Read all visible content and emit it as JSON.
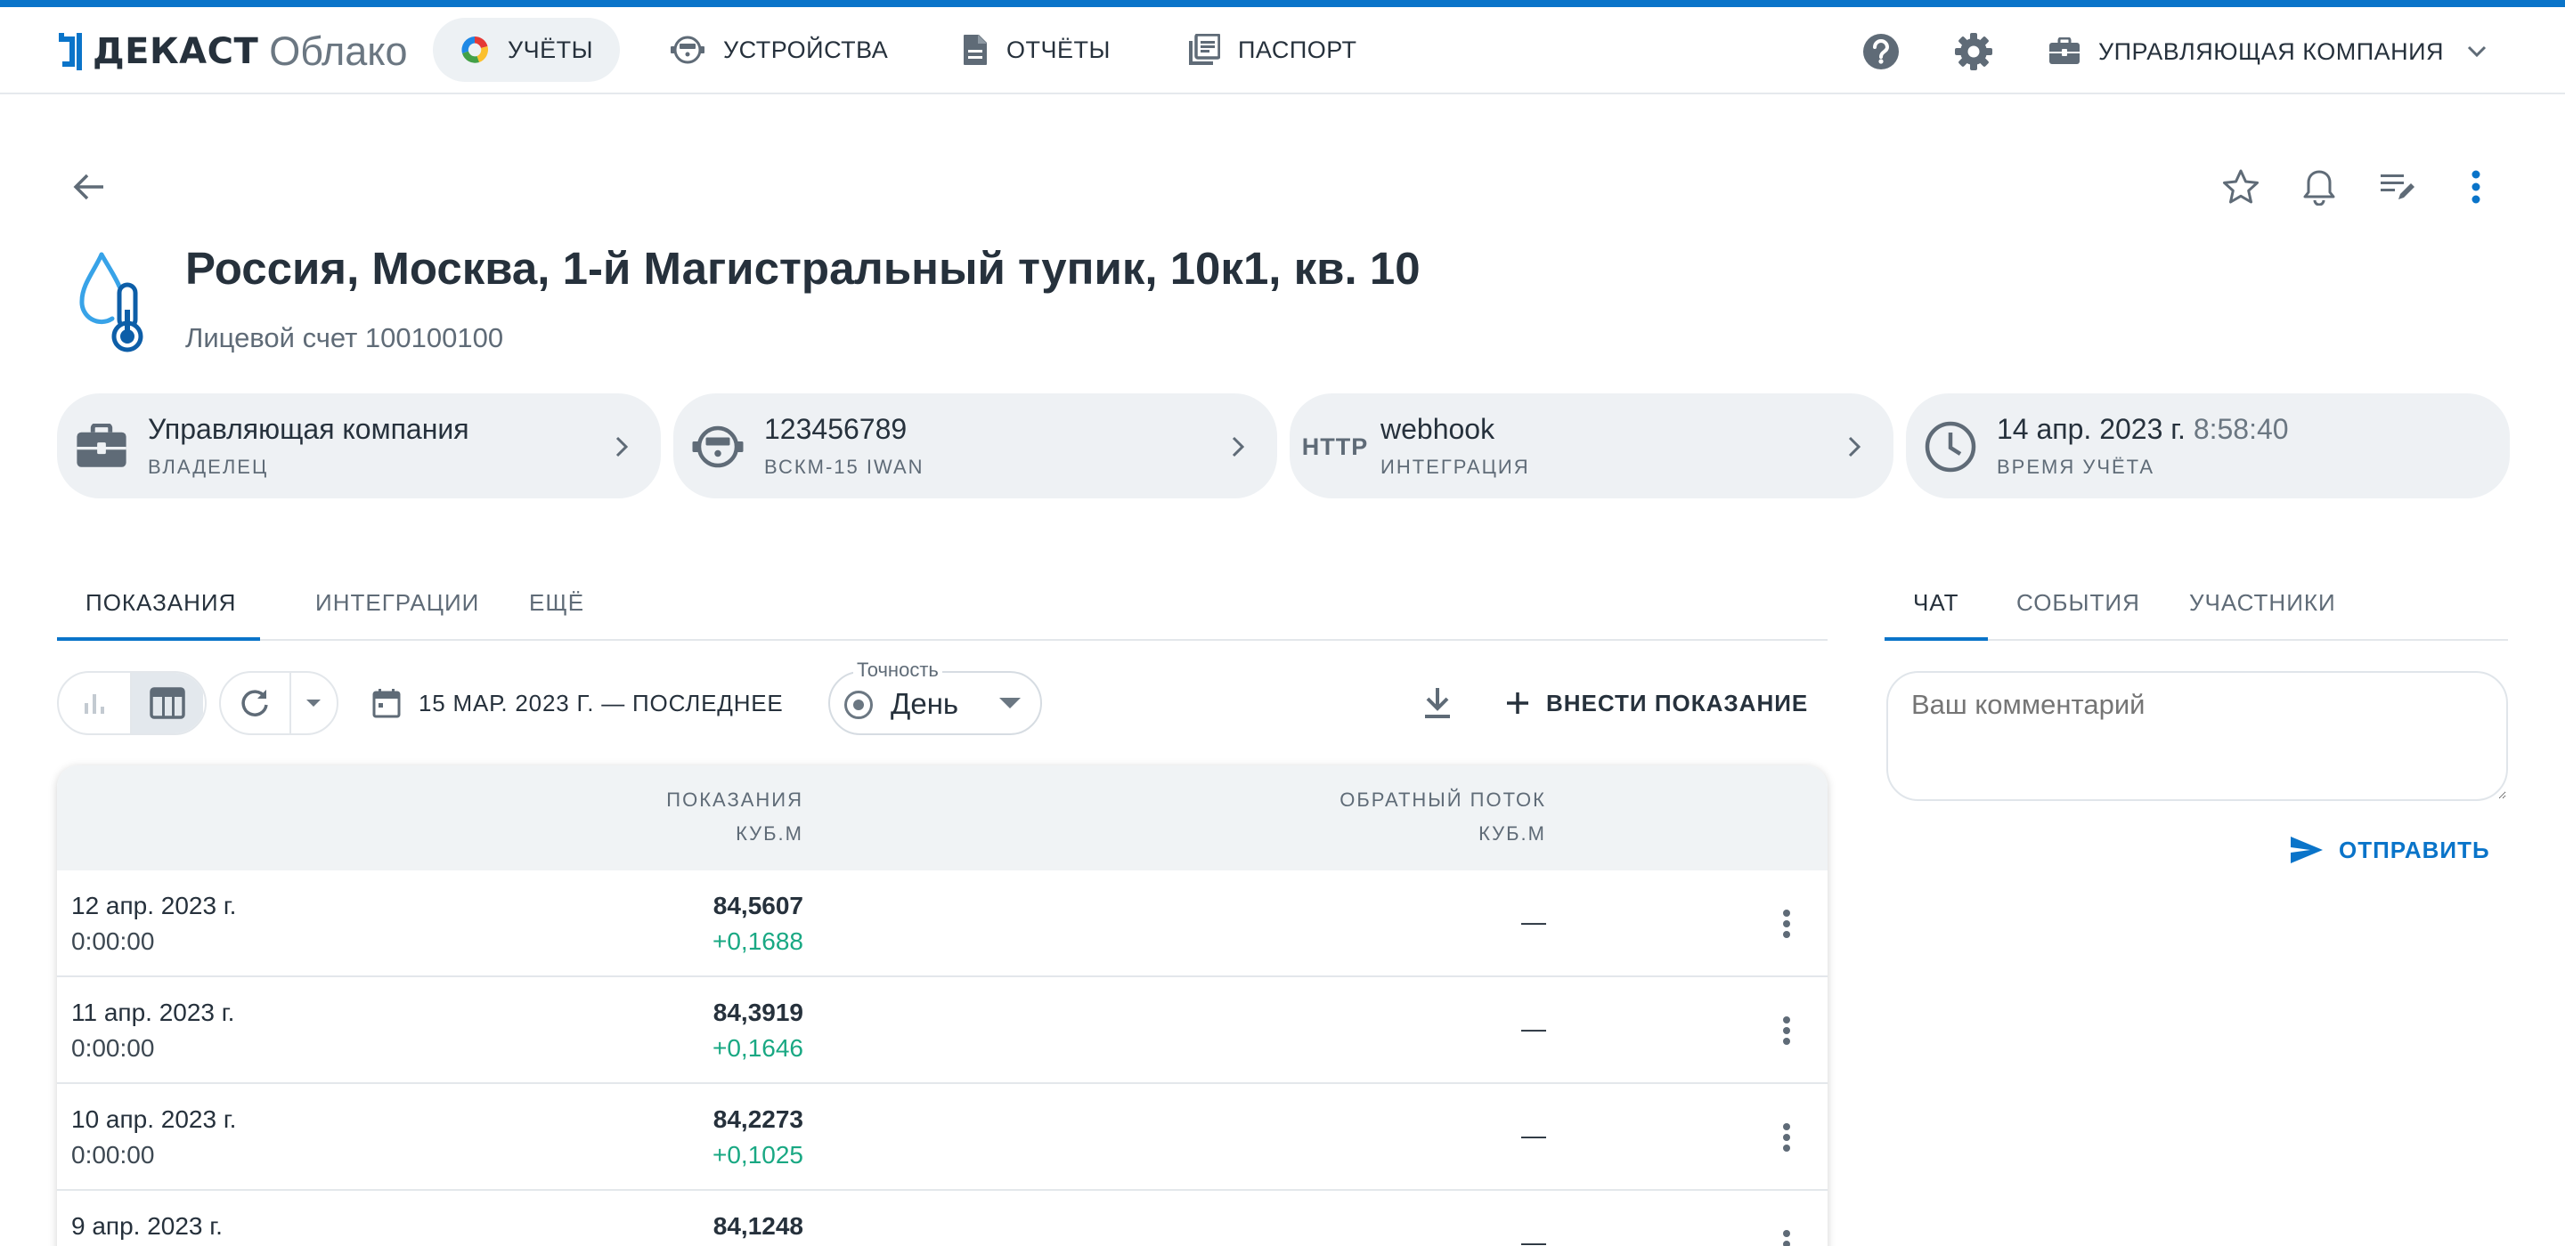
{
  "brand": {
    "name": "ДЕКАСТ",
    "product": "Облако"
  },
  "nav": [
    {
      "label": "УЧЁТЫ",
      "icon": "donut-icon",
      "active": true
    },
    {
      "label": "УСТРОЙСТВА",
      "icon": "meter-device-icon",
      "active": false
    },
    {
      "label": "ОТЧЁТЫ",
      "icon": "document-icon",
      "active": false
    },
    {
      "label": "ПАСПОРТ",
      "icon": "library-icon",
      "active": false
    }
  ],
  "header": {
    "company_label": "УПРАВЛЯЮЩАЯ КОМПАНИЯ"
  },
  "page": {
    "title": "Россия, Москва, 1-й Магистральный тупик, 10к1, кв. 10",
    "subtitle": "Лицевой счет 100100100"
  },
  "chips": [
    {
      "main": "Управляющая компания",
      "sub": "ВЛАДЕЛЕЦ",
      "icon": "briefcase-icon"
    },
    {
      "main": "123456789",
      "sub": "ВСКМ-15 IWAN",
      "icon": "meter-device-icon"
    },
    {
      "main": "webhook",
      "sub": "ИНТЕГРАЦИЯ",
      "icon_text": "HTTP"
    },
    {
      "main_date": "14 апр. 2023 г.",
      "main_time": "8:58:40",
      "sub": "ВРЕМЯ УЧЁТА",
      "icon": "clock-icon"
    }
  ],
  "tabs": [
    "ПОКАЗАНИЯ",
    "ИНТЕГРАЦИИ",
    "ЕЩЁ"
  ],
  "right_tabs": [
    "ЧАТ",
    "СОБЫТИЯ",
    "УЧАСТНИКИ"
  ],
  "toolbar": {
    "date_range": "15 МАР. 2023 Г. — ПОСЛЕДНЕЕ",
    "precision_label": "Точность",
    "precision_value": "День",
    "add_label": "ВНЕСТИ ПОКАЗАНИЕ"
  },
  "table": {
    "columns": [
      {
        "title": "ПОКАЗАНИЯ",
        "unit": "КУБ.М"
      },
      {
        "title": "ОБРАТНЫЙ ПОТОК",
        "unit": "КУБ.М"
      }
    ],
    "rows": [
      {
        "date": "12 апр. 2023 г.",
        "time": "0:00:00",
        "value": "84,5607",
        "delta": "+0,1688",
        "reverse": "—"
      },
      {
        "date": "11 апр. 2023 г.",
        "time": "0:00:00",
        "value": "84,3919",
        "delta": "+0,1646",
        "reverse": "—"
      },
      {
        "date": "10 апр. 2023 г.",
        "time": "0:00:00",
        "value": "84,2273",
        "delta": "+0,1025",
        "reverse": "—"
      },
      {
        "date": "9 апр. 2023 г.",
        "time": "",
        "value": "84,1248",
        "delta": "",
        "reverse": "—"
      }
    ]
  },
  "chat": {
    "placeholder": "Ваш комментарий",
    "send_label": "ОТПРАВИТЬ"
  },
  "colors": {
    "accent": "#0a74c9",
    "positive": "#19a883",
    "chip_bg": "#eef1f4"
  }
}
